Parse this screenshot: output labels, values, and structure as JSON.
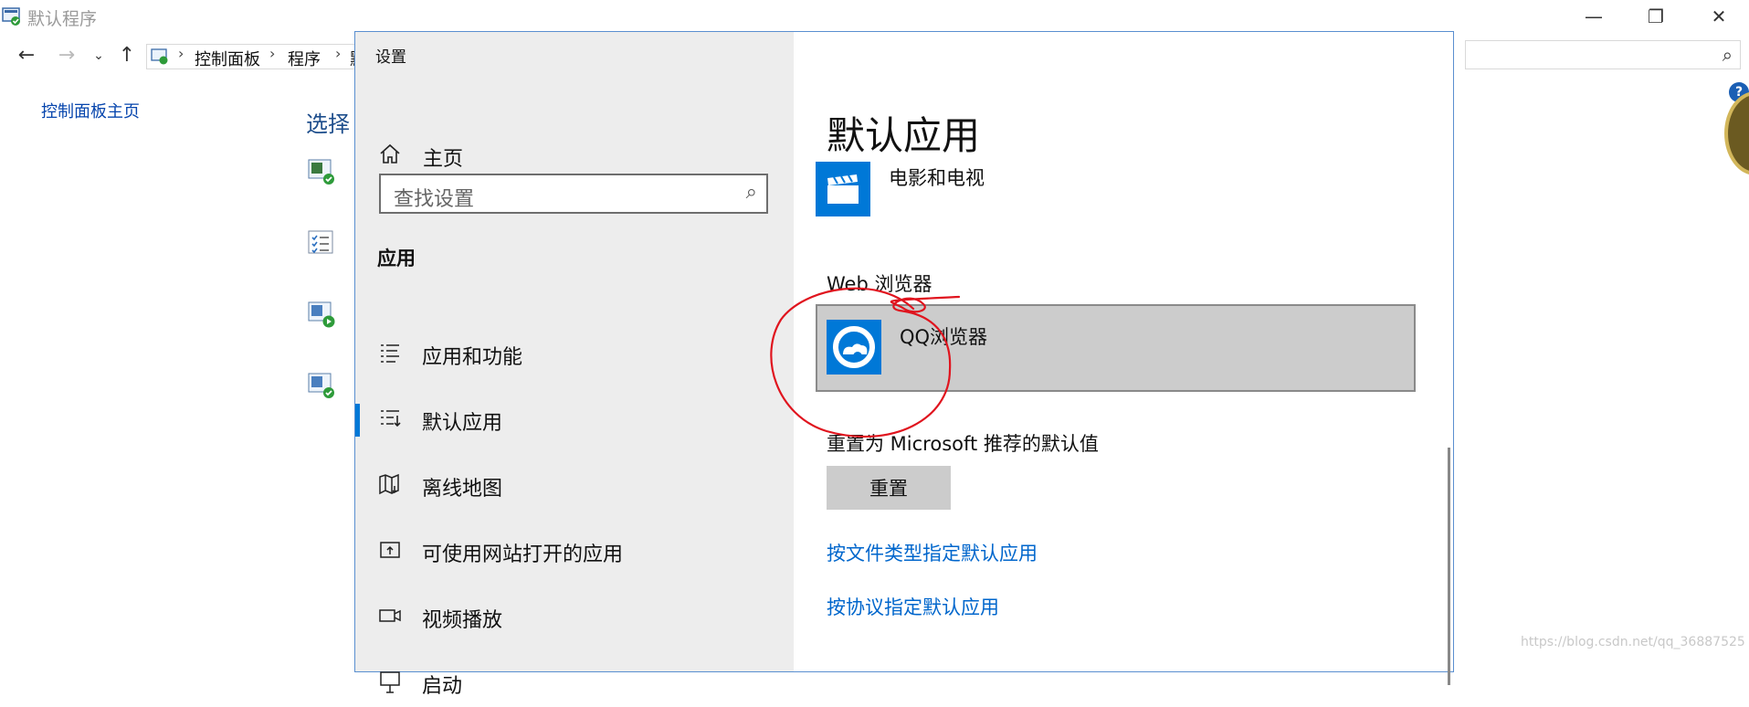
{
  "control_panel": {
    "window_title": "默认程序",
    "breadcrumb": [
      "控制面板",
      "程序",
      "默"
    ],
    "home_link": "控制面板主页",
    "choose_heading": "选择",
    "window_controls": {
      "minimize": "—",
      "restore": "❐",
      "close": "✕"
    }
  },
  "settings": {
    "window_title": "设置",
    "window_controls": {
      "minimize": "—",
      "maximize": "☐",
      "close": "✕"
    },
    "nav": {
      "home_label": "主页",
      "search_placeholder": "查找设置",
      "section_heading": "应用",
      "items": [
        {
          "label": "应用和功能",
          "icon": "apps-features-icon"
        },
        {
          "label": "默认应用",
          "icon": "default-apps-icon",
          "selected": true
        },
        {
          "label": "离线地图",
          "icon": "offline-maps-icon"
        },
        {
          "label": "可使用网站打开的应用",
          "icon": "apps-for-websites-icon"
        },
        {
          "label": "视频播放",
          "icon": "video-playback-icon"
        },
        {
          "label": "启动",
          "icon": "startup-icon"
        }
      ]
    },
    "content": {
      "page_title": "默认应用",
      "video_player_app": "电影和电视",
      "web_browser_label": "Web 浏览器",
      "web_browser_app": "QQ浏览器",
      "reset_label": "重置为 Microsoft 推荐的默认值",
      "reset_button": "重置",
      "links": [
        "按文件类型指定默认应用",
        "按协议指定默认应用"
      ]
    }
  },
  "watermark": "https://blog.csdn.net/qq_36887525",
  "colors": {
    "accent": "#0078d7",
    "link": "#0066cc",
    "annotation": "#e0141e"
  }
}
